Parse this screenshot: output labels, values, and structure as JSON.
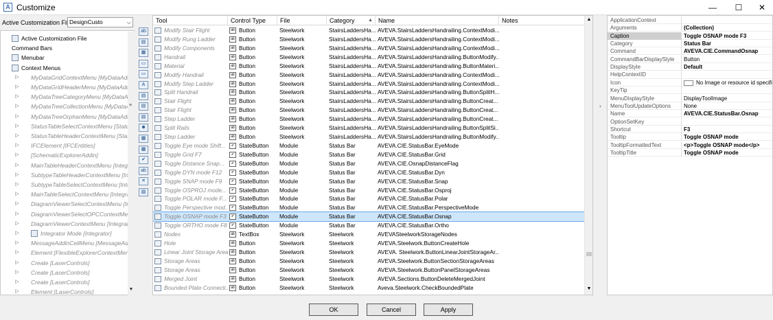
{
  "window": {
    "title": "Customize"
  },
  "left": {
    "acf_label": "Active Customization File",
    "acf_value": "DesignCusto",
    "tree": [
      {
        "label": "Active Customization File",
        "indent": 16,
        "icon": true,
        "exp": "",
        "disabled": false
      },
      {
        "label": "Command Bars",
        "indent": 16,
        "icon": false,
        "exp": "",
        "disabled": false
      },
      {
        "label": "Menubar",
        "indent": 16,
        "icon": true,
        "exp": "",
        "disabled": false
      },
      {
        "label": "Context Menus",
        "indent": 16,
        "icon": true,
        "exp": "◢",
        "disabled": false
      },
      {
        "label": "MyDataGridContextMenu [MyDataAdd",
        "indent": 44,
        "icon": false,
        "exp": "▷",
        "disabled": true
      },
      {
        "label": "MyDataGridHeaderMenu [MyDataAddi",
        "indent": 44,
        "icon": false,
        "exp": "▷",
        "disabled": true
      },
      {
        "label": "MyDataTreeCategoryMenu [MyDataA",
        "indent": 44,
        "icon": false,
        "exp": "▷",
        "disabled": true
      },
      {
        "label": "MyDataTreeCollectionMenu [MyDataA",
        "indent": 44,
        "icon": false,
        "exp": "▷",
        "disabled": true
      },
      {
        "label": "MyDataTreeOrphanMenu [MyDataAdd",
        "indent": 44,
        "icon": false,
        "exp": "▷",
        "disabled": true
      },
      {
        "label": "StatusTableSelectContextMenu [Statu",
        "indent": 44,
        "icon": false,
        "exp": "▷",
        "disabled": true
      },
      {
        "label": "StatusTableHeaderContextMenu [Stat",
        "indent": 44,
        "icon": false,
        "exp": "▷",
        "disabled": true
      },
      {
        "label": "IFCElement [IFCEntities]",
        "indent": 44,
        "icon": false,
        "exp": "▷",
        "disabled": true
      },
      {
        "label": "[SchematicExplorerAddin]",
        "indent": 44,
        "icon": false,
        "exp": "▷",
        "disabled": true
      },
      {
        "label": "MainTableHeaderContextMenu [Integr",
        "indent": 44,
        "icon": false,
        "exp": "▷",
        "disabled": true
      },
      {
        "label": "SubtypeTableHeaderContextMenu [Int",
        "indent": 44,
        "icon": false,
        "exp": "▷",
        "disabled": true
      },
      {
        "label": "SubtypeTableSelectContextMenu [Inte",
        "indent": 44,
        "icon": false,
        "exp": "▷",
        "disabled": true
      },
      {
        "label": "MainTableSelectContextMenu [Integra",
        "indent": 44,
        "icon": false,
        "exp": "▷",
        "disabled": true
      },
      {
        "label": "DiagramViewerSelectContextMenu [In",
        "indent": 44,
        "icon": false,
        "exp": "▷",
        "disabled": true
      },
      {
        "label": "DiagramViewerSelectOPCContextMe",
        "indent": 44,
        "icon": false,
        "exp": "▷",
        "disabled": true
      },
      {
        "label": "DiagramViewerContextMenu [Integrat",
        "indent": 44,
        "icon": false,
        "exp": "▷",
        "disabled": true
      },
      {
        "label": "Integrator Mode [Integrator]",
        "indent": 44,
        "icon": true,
        "exp": "▷",
        "disabled": true
      },
      {
        "label": "MessageAddinCellMenu [MessageAd",
        "indent": 44,
        "icon": false,
        "exp": "▷",
        "disabled": true
      },
      {
        "label": "Element [FlexibleExplorerContextMen",
        "indent": 44,
        "icon": false,
        "exp": "▷",
        "disabled": true
      },
      {
        "label": "Create [LaserControls]",
        "indent": 44,
        "icon": false,
        "exp": "▷",
        "disabled": true
      },
      {
        "label": "Create [LaserControls]",
        "indent": 44,
        "icon": false,
        "exp": "▷",
        "disabled": true
      },
      {
        "label": "Create [LaserControls]",
        "indent": 44,
        "icon": false,
        "exp": "▷",
        "disabled": true
      },
      {
        "label": "Element [LaserControls]",
        "indent": 44,
        "icon": false,
        "exp": "▷",
        "disabled": true
      }
    ]
  },
  "toolbar": {
    "icons": [
      "ab",
      "▤",
      "▦",
      "▭",
      "▭",
      "A",
      "▤",
      "▤",
      "▤",
      "☻",
      "▦",
      "▦",
      "✔",
      "ab",
      "✕",
      "▨"
    ]
  },
  "grid": {
    "columns": [
      "Tool",
      "Control Type",
      "File",
      "Category",
      "Name",
      "Notes"
    ],
    "rows": [
      {
        "tool": "Modify Stair Flight",
        "ctype": "Button",
        "file": "Steelwork",
        "cat": "StairsLaddersHa...",
        "name": "AVEVA.StairsLaddersHandrailing.ContextModi..."
      },
      {
        "tool": "Modify Rung Ladder",
        "ctype": "Button",
        "file": "Steelwork",
        "cat": "StairsLaddersHa...",
        "name": "AVEVA.StairsLaddersHandrailing.ContextModi..."
      },
      {
        "tool": "Modify Components",
        "ctype": "Button",
        "file": "Steelwork",
        "cat": "StairsLaddersHa...",
        "name": "AVEVA.StairsLaddersHandrailing.ContextModi..."
      },
      {
        "tool": "Handrail",
        "ctype": "Button",
        "file": "Steelwork",
        "cat": "StairsLaddersHa...",
        "name": "AVEVA.StairsLaddersHandrailing.ButtonModify..."
      },
      {
        "tool": "Material",
        "ctype": "Button",
        "file": "Steelwork",
        "cat": "StairsLaddersHa...",
        "name": "AVEVA.StairsLaddersHandrailing.ButtonMateri..."
      },
      {
        "tool": "Modify Handrail",
        "ctype": "Button",
        "file": "Steelwork",
        "cat": "StairsLaddersHa...",
        "name": "AVEVA.StairsLaddersHandrailing.ContextModi..."
      },
      {
        "tool": "Modify Step Ladder",
        "ctype": "Button",
        "file": "Steelwork",
        "cat": "StairsLaddersHa...",
        "name": "AVEVA.StairsLaddersHandrailing.ContextModi..."
      },
      {
        "tool": "Split Handrail",
        "ctype": "Button",
        "file": "Steelwork",
        "cat": "StairsLaddersHa...",
        "name": "AVEVA.StairsLaddersHandrailing.ButtonSplitH..."
      },
      {
        "tool": "Stair Flight",
        "ctype": "Button",
        "file": "Steelwork",
        "cat": "StairsLaddersHa...",
        "name": "AVEVA.StairsLaddersHandrailing.ButtonCreat..."
      },
      {
        "tool": "Stair Flight",
        "ctype": "Button",
        "file": "Steelwork",
        "cat": "StairsLaddersHa...",
        "name": "AVEVA.StairsLaddersHandrailing.ButtonCreat..."
      },
      {
        "tool": "Step Ladder",
        "ctype": "Button",
        "file": "Steelwork",
        "cat": "StairsLaddersHa...",
        "name": "AVEVA.StairsLaddersHandrailing.ButtonCreat..."
      },
      {
        "tool": "Split Rails",
        "ctype": "Button",
        "file": "Steelwork",
        "cat": "StairsLaddersHa...",
        "name": "AVEVA.StairsLaddersHandrailing.ButtonSplitSi..."
      },
      {
        "tool": "Step Ladder",
        "ctype": "Button",
        "file": "Steelwork",
        "cat": "StairsLaddersHa...",
        "name": "AVEVA.StairsLaddersHandrailing.ButtonModify..."
      },
      {
        "tool": "Toggle Eye mode Shift...",
        "ctype": "StateButton",
        "file": "Module",
        "cat": "Status Bar",
        "name": "AVEVA.CIE.StatusBar.EyeMode"
      },
      {
        "tool": "Toggle Grid F7",
        "ctype": "StateButton",
        "file": "Module",
        "cat": "Status Bar",
        "name": "AVEVA.CIE.StatusBar.Grid"
      },
      {
        "tool": "Toggle Distance Snap...",
        "ctype": "StateButton",
        "file": "Module",
        "cat": "Status Bar",
        "name": "AVEVA.CIE.OsnapDistanceFlag"
      },
      {
        "tool": "Toggle DYN mode F12",
        "ctype": "StateButton",
        "file": "Module",
        "cat": "Status Bar",
        "name": "AVEVA.CIE.StatusBar.Dyn"
      },
      {
        "tool": "Toggle SNAP mode F9",
        "ctype": "StateButton",
        "file": "Module",
        "cat": "Status Bar",
        "name": "AVEVA.CIE.StatusBar.Snap"
      },
      {
        "tool": "Toggle OSPROJ mode...",
        "ctype": "StateButton",
        "file": "Module",
        "cat": "Status Bar",
        "name": "AVEVA.CIE.StatusBar.Osproj"
      },
      {
        "tool": "Toggle POLAR mode F...",
        "ctype": "StateButton",
        "file": "Module",
        "cat": "Status Bar",
        "name": "AVEVA.CIE.StatusBar.Polar"
      },
      {
        "tool": "Toggle Perspective mod...",
        "ctype": "StateButton",
        "file": "Module",
        "cat": "Status Bar",
        "name": "AVEVA.CIE.StatusBar.PerspectiveMode"
      },
      {
        "tool": "Toggle OSNAP mode F3",
        "ctype": "StateButton",
        "file": "Module",
        "cat": "Status Bar",
        "name": "AVEVA.CIE.StatusBar.Osnap",
        "selected": true
      },
      {
        "tool": "Toggle ORTHO mode F8",
        "ctype": "StateButton",
        "file": "Module",
        "cat": "Status Bar",
        "name": "AVEVA.CIE.StatusBar.Ortho"
      },
      {
        "tool": "Nodes",
        "ctype": "TextBox",
        "file": "Steelwork",
        "cat": "Steelwork",
        "name": "AVEVASteelworkStorageNodes"
      },
      {
        "tool": "Hole",
        "ctype": "Button",
        "file": "Steelwork",
        "cat": "Steelwork",
        "name": "AVEVA.Steelwork.ButtonCreateHole"
      },
      {
        "tool": "Linear Joint Storage Area",
        "ctype": "Button",
        "file": "Steelwork",
        "cat": "Steelwork",
        "name": "AVEVA. Steelwork.ButtonLinearJointStorageAr..."
      },
      {
        "tool": "Storage Areas",
        "ctype": "Button",
        "file": "Steelwork",
        "cat": "Steelwork",
        "name": "AVEVA.Steelwork.ButtonSectionStorageAreas"
      },
      {
        "tool": "Storage Areas",
        "ctype": "Button",
        "file": "Steelwork",
        "cat": "Steelwork",
        "name": "AVEVA.Steelwork.ButtonPanelStorageAreas"
      },
      {
        "tool": "Merged Joint",
        "ctype": "Button",
        "file": "Steelwork",
        "cat": "Steelwork",
        "name": "AVEVA.Sections.ButtonDeleteMergedJoint"
      },
      {
        "tool": "Bounded Plate Connecti...",
        "ctype": "Button",
        "file": "Steelwork",
        "cat": "Steelwork",
        "name": "Aveva.Steelwork.CheckBoundedPlate"
      }
    ]
  },
  "props": {
    "rows": [
      {
        "key": "ApplicationContext",
        "value": "",
        "bold": false
      },
      {
        "key": "Arguments",
        "value": "(Collection)",
        "bold": true
      },
      {
        "key": "Caption",
        "value": "Toggle OSNAP mode F3",
        "bold": true,
        "selected": true
      },
      {
        "key": "Category",
        "value": "Status Bar",
        "bold": true
      },
      {
        "key": "Command",
        "value": "AVEVA.CIE.CommandOsnap",
        "bold": true
      },
      {
        "key": "CommandBarDisplayStyle",
        "value": "Button",
        "bold": false
      },
      {
        "key": "DisplayStyle",
        "value": "Default",
        "bold": true
      },
      {
        "key": "HelpContextID",
        "value": "",
        "bold": false
      },
      {
        "key": "Icon",
        "value": "No Image or resource id specified",
        "bold": false,
        "iconbox": true
      },
      {
        "key": "KeyTip",
        "value": "",
        "bold": false
      },
      {
        "key": "MenuDisplayStyle",
        "value": "DisplayToolImage",
        "bold": false
      },
      {
        "key": "MenuToolUpdateOptions",
        "value": "None",
        "bold": false
      },
      {
        "key": "Name",
        "value": "AVEVA.CIE.StatusBar.Osnap",
        "bold": true
      },
      {
        "key": "OptionSetKey",
        "value": "",
        "bold": false
      },
      {
        "key": "Shortcut",
        "value": "F3",
        "bold": true
      },
      {
        "key": "Tooltip",
        "value": "Toggle OSNAP mode",
        "bold": true
      },
      {
        "key": "TooltipFormattedText",
        "value": "<p>Toggle OSNAP mode</p>",
        "bold": true
      },
      {
        "key": "TooltipTitle",
        "value": "Toggle OSNAP mode",
        "bold": true
      }
    ]
  },
  "buttons": {
    "ok": "OK",
    "cancel": "Cancel",
    "apply": "Apply"
  }
}
